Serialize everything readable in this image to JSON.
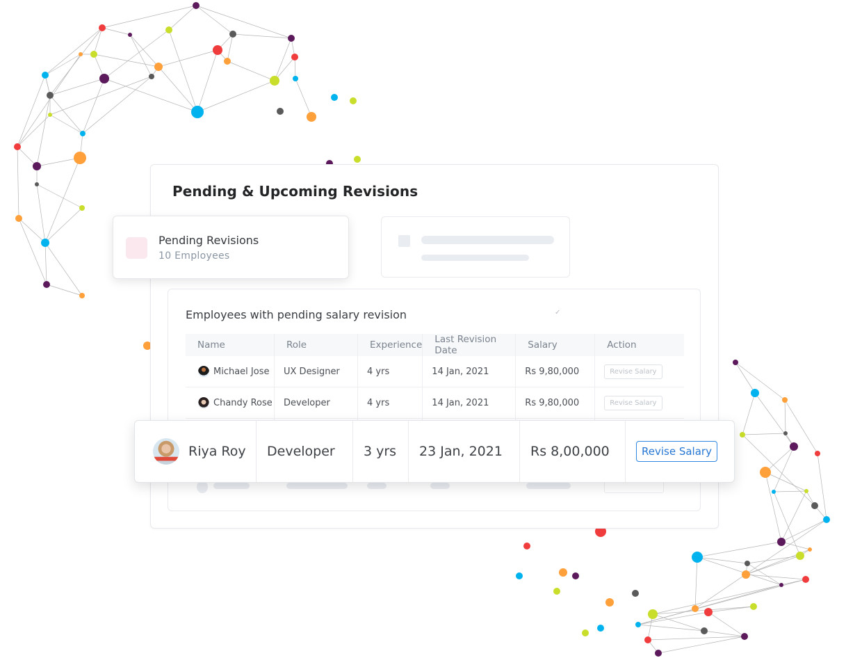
{
  "colors": {
    "accent_blue": "#2677d4",
    "pending_icon_bg": "#fbe8ee",
    "node_palette": [
      "#5c1a5c",
      "#f03c3c",
      "#c9de2a",
      "#5a5a5a",
      "#00b3ee",
      "#ffa03a"
    ]
  },
  "main_card": {
    "title": "Pending & Upcoming Revisions"
  },
  "pending_card": {
    "icon": "pending-revisions-icon",
    "title": "Pending Revisions",
    "subtitle": "10 Employees"
  },
  "table_panel": {
    "title": "Employees with pending salary revision",
    "columns": [
      "Name",
      "Role",
      "Experience",
      "Last Revision Date",
      "Salary",
      "Action"
    ],
    "rows": [
      {
        "name": "Michael Jose",
        "avatar": "avatar-michael-jose",
        "role": "UX Designer",
        "experience": "4 yrs",
        "last_revision": "14 Jan, 2021",
        "salary": "Rs 9,80,000",
        "action": "Revise Salary"
      },
      {
        "name": "Chandy Rose",
        "avatar": "avatar-chandy-rose",
        "role": "Developer",
        "experience": "4 yrs",
        "last_revision": "14 Jan, 2021",
        "salary": "Rs 9,80,000",
        "action": "Revise Salary"
      }
    ]
  },
  "highlighted_row": {
    "name": "Riya Roy",
    "avatar": "avatar-riya-roy",
    "role": "Developer",
    "experience": "3 yrs",
    "last_revision": "23 Jan, 2021",
    "salary": "Rs 8,00,000",
    "action": "Revise Salary"
  }
}
